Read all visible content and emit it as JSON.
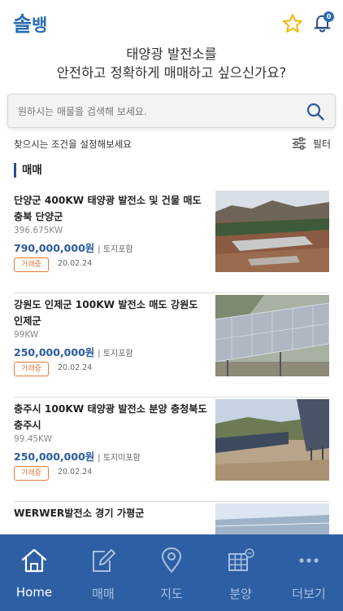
{
  "app": {
    "logo_line1": "솔",
    "logo_line2": "뱅",
    "notification_count": "0"
  },
  "headline": {
    "line1": "태양광 발전소를",
    "line2": "안전하고 정확하게 매매하고 싶으신가요?"
  },
  "search": {
    "placeholder": "원하시는 매물을 검색해 보세요."
  },
  "conditions": {
    "hint": "찾으시는 조건을 설정해보세요",
    "filter_label": "필터"
  },
  "section": {
    "title": "매매"
  },
  "listings": [
    {
      "title": "단양군 400KW 태양광 발전소 및 건물 매도 충북 단양군",
      "capacity": "396.675KW",
      "price": "790,000,000원",
      "land": "| 토지포함",
      "status": "거래중",
      "date": "20.02.24"
    },
    {
      "title": "강원도 인제군 100KW 발전소 매도 강원도 인제군",
      "capacity": "99KW",
      "price": "250,000,000원",
      "land": "| 토지포함",
      "status": "거래중",
      "date": "20.02.24"
    },
    {
      "title": "충주시 100KW 태양광 발전소 분양 충청북도 충주시",
      "capacity": "99.45KW",
      "price": "250,000,000원",
      "land": "| 토지미포함",
      "status": "거래중",
      "date": "20.02.24"
    },
    {
      "title": "WERWER발전소 경기 가평군",
      "capacity": "",
      "price": "",
      "land": "",
      "status": "",
      "date": ""
    }
  ],
  "tabbar": {
    "home": "Home",
    "trade": "매매",
    "map": "지도",
    "sale": "분양",
    "more": "더보기"
  },
  "colors": {
    "brand_blue": "#2e5fa4",
    "price_blue": "#2a5aa0",
    "status_orange": "#e0793a"
  }
}
